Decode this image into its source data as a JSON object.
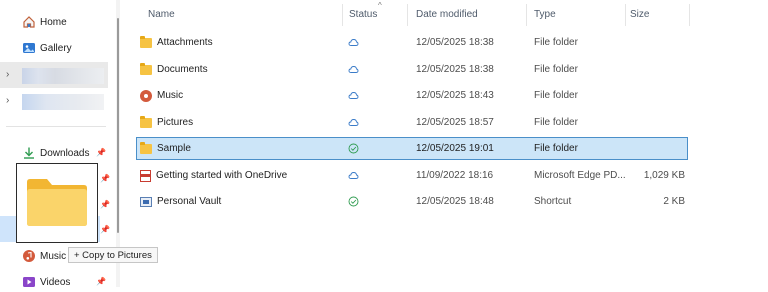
{
  "nav": {
    "home_label": "Home",
    "gallery_label": "Gallery",
    "downloads_label": "Downloads",
    "music_label": "Music",
    "videos_label": "Videos"
  },
  "drag": {
    "tooltip_label": "+ Copy to Pictures"
  },
  "columns": {
    "name": "Name",
    "status": "Status",
    "date_modified": "Date modified",
    "type": "Type",
    "size": "Size"
  },
  "files": [
    {
      "name": "Attachments",
      "icon": "folder-icon",
      "status_icon": "cloud-icon",
      "date": "12/05/2025 18:38",
      "type": "File folder",
      "size": ""
    },
    {
      "name": "Documents",
      "icon": "folder-icon",
      "status_icon": "cloud-icon",
      "date": "12/05/2025 18:38",
      "type": "File folder",
      "size": ""
    },
    {
      "name": "Music",
      "icon": "music-folder-icon",
      "status_icon": "cloud-icon",
      "date": "12/05/2025 18:43",
      "type": "File folder",
      "size": ""
    },
    {
      "name": "Pictures",
      "icon": "folder-icon",
      "status_icon": "cloud-icon",
      "date": "12/05/2025 18:57",
      "type": "File folder",
      "size": ""
    },
    {
      "name": "Sample",
      "icon": "folder-icon",
      "status_icon": "synced-check-icon",
      "date": "12/05/2025 19:01",
      "type": "File folder",
      "size": ""
    },
    {
      "name": "Getting started with OneDrive",
      "icon": "pdf-icon",
      "status_icon": "cloud-icon",
      "date": "11/09/2022 18:16",
      "type": "Microsoft Edge PD...",
      "size": "1,029 KB"
    },
    {
      "name": "Personal Vault",
      "icon": "vault-shortcut-icon",
      "status_icon": "synced-check-icon",
      "date": "12/05/2025 18:48",
      "type": "Shortcut",
      "size": "2 KB"
    }
  ],
  "colors": {
    "selection_fill": "#cce5f8",
    "selection_border": "#4a8fc9",
    "cloud_icon": "#3a7bc8",
    "synced_icon": "#2e9b4f",
    "folder": "#f6c343"
  }
}
